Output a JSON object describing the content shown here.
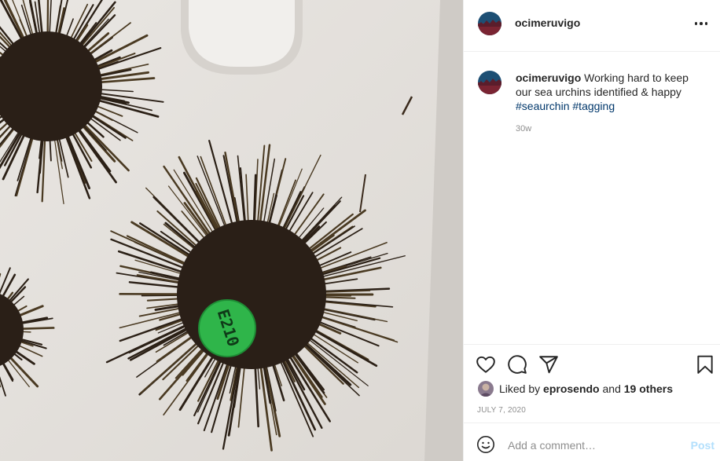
{
  "post": {
    "username": "ocimeruvigo",
    "caption": {
      "username": "ocimeruvigo",
      "text": "Working hard to keep our sea urchins identified & happy",
      "hashtags": [
        "#seaurchin",
        "#tagging"
      ],
      "time_ago": "30w"
    },
    "photo": {
      "tag_label": "E210",
      "tag_color": "#2fb54a",
      "board_color": "#e5e2de",
      "urchin_color": "#2a1f17"
    },
    "likes": {
      "prefix": "Liked by",
      "user": "eprosendo",
      "conjunction": "and",
      "others": "19 others"
    },
    "date": "JULY 7, 2020",
    "comment": {
      "placeholder": "Add a comment…",
      "post_label": "Post"
    }
  },
  "icons": {
    "more": "more-options-icon",
    "like": "heart-icon",
    "comment": "comment-icon",
    "share": "share-paper-plane-icon",
    "save": "bookmark-icon",
    "emoji": "emoji-icon"
  },
  "colors": {
    "text": "#262626",
    "muted": "#8e8e8e",
    "hashtag": "#00376b",
    "post_button": "#b2dffc",
    "divider": "#efefef"
  }
}
